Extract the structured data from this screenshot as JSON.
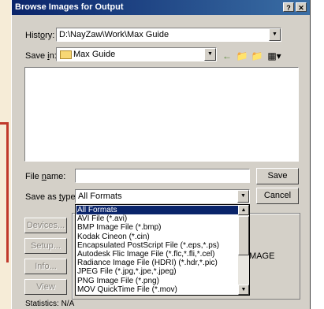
{
  "window": {
    "title": "Browse Images for Output",
    "help_label": "?",
    "close_label": "✕"
  },
  "history": {
    "label_pre": "Hist",
    "label_key": "o",
    "label_post": "ry:",
    "value": "D:\\NayZaw\\Work\\Max Guide"
  },
  "save_in": {
    "label_pre": "Save ",
    "label_key": "i",
    "label_post": "n:",
    "value": "Max Guide"
  },
  "toolbar": {
    "back_icon": "←",
    "up_icon": "📁",
    "new_folder_icon": "📁",
    "view_menu_icon": "▦▾"
  },
  "file_name": {
    "label_pre": "File ",
    "label_key": "n",
    "label_post": "ame:",
    "value": ""
  },
  "save_as_type": {
    "label_pre": "Save as ",
    "label_key": "t",
    "label_post": "ype:",
    "value": "All Formats"
  },
  "buttons": {
    "save": "Save",
    "cancel": "Cancel",
    "devices": "Devices...",
    "setup": "Setup...",
    "info": "Info...",
    "view": "View"
  },
  "dropdown_items": [
    "All Formats",
    "AVI File (*.avi)",
    "BMP Image File (*.bmp)",
    "Kodak Cineon (*.cin)",
    "Encapsulated PostScript File (*.eps,*.ps)",
    "Autodesk Flic Image File (*.flc,*.fli,*.cel)",
    "Radiance Image File (HDRI) (*.hdr,*.pic)",
    "JPEG File (*.jpg,*.jpe,*.jpeg)",
    "PNG Image File (*.png)",
    "MOV QuickTime File (*.mov)"
  ],
  "image_label": "IMAGE",
  "statistics": "Statistics:  N/A"
}
